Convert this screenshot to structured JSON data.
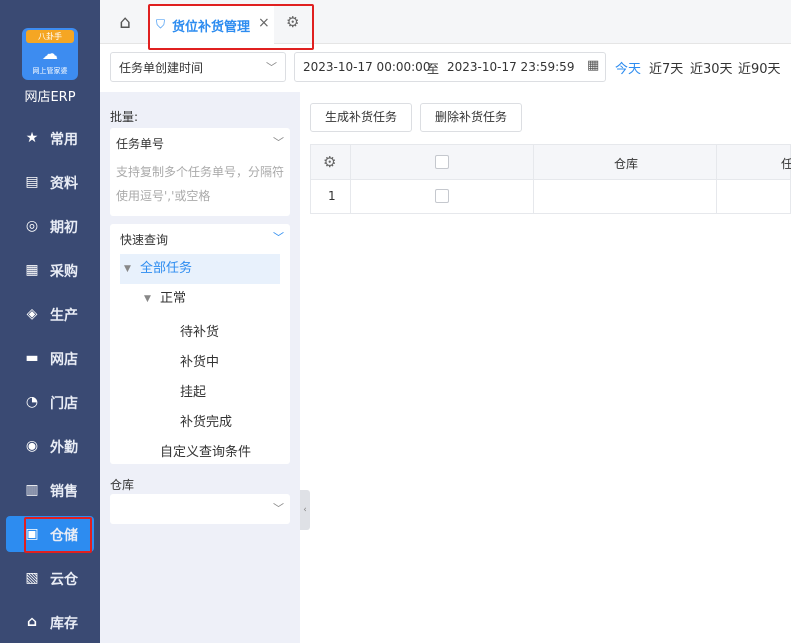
{
  "app": {
    "logo_ribbon": "八卦手",
    "logo_sub": "网上管家婆",
    "name": "网店ERP"
  },
  "sidebar": {
    "items": [
      {
        "label": "常用",
        "icon": "star-icon"
      },
      {
        "label": "资料",
        "icon": "document-icon"
      },
      {
        "label": "期初",
        "icon": "target-icon"
      },
      {
        "label": "采购",
        "icon": "purchase-icon"
      },
      {
        "label": "生产",
        "icon": "production-icon"
      },
      {
        "label": "网店",
        "icon": "store-icon"
      },
      {
        "label": "门店",
        "icon": "pie-icon"
      },
      {
        "label": "外勤",
        "icon": "field-icon"
      },
      {
        "label": "销售",
        "icon": "bar-chart-icon"
      },
      {
        "label": "仓储",
        "icon": "warehouse-icon",
        "active": true
      },
      {
        "label": "云仓",
        "icon": "cloud-warehouse-icon"
      },
      {
        "label": "库存",
        "icon": "inventory-icon"
      }
    ]
  },
  "tabs": {
    "active_label": "货位补货管理",
    "close": "×"
  },
  "filter": {
    "date_field": "任务单创建时间",
    "start": "2023-10-17 00:00:00",
    "to": "至",
    "end": "2023-10-17 23:59:59",
    "quick": [
      "今天",
      "近7天",
      "近30天",
      "近90天"
    ]
  },
  "left": {
    "batch_label": "批量:",
    "batch_field": "任务单号",
    "batch_placeholder": "支持复制多个任务单号，分隔符使用逗号','或空格",
    "quick_query": "快速查询",
    "tree": {
      "all": "全部任务",
      "normal": "正常",
      "children": [
        "待补货",
        "补货中",
        "挂起",
        "补货完成"
      ],
      "custom": "自定义查询条件"
    },
    "warehouse_label": "仓库",
    "warehouse_value": ""
  },
  "toolbar": {
    "generate": "生成补货任务",
    "delete": "删除补货任务"
  },
  "table": {
    "columns": [
      "仓库",
      "任"
    ],
    "rows": [
      {
        "index": "1"
      }
    ]
  },
  "colors": {
    "accent": "#2d8cf0",
    "sidebar_bg": "#3a4a73",
    "highlight": "#e02020"
  }
}
